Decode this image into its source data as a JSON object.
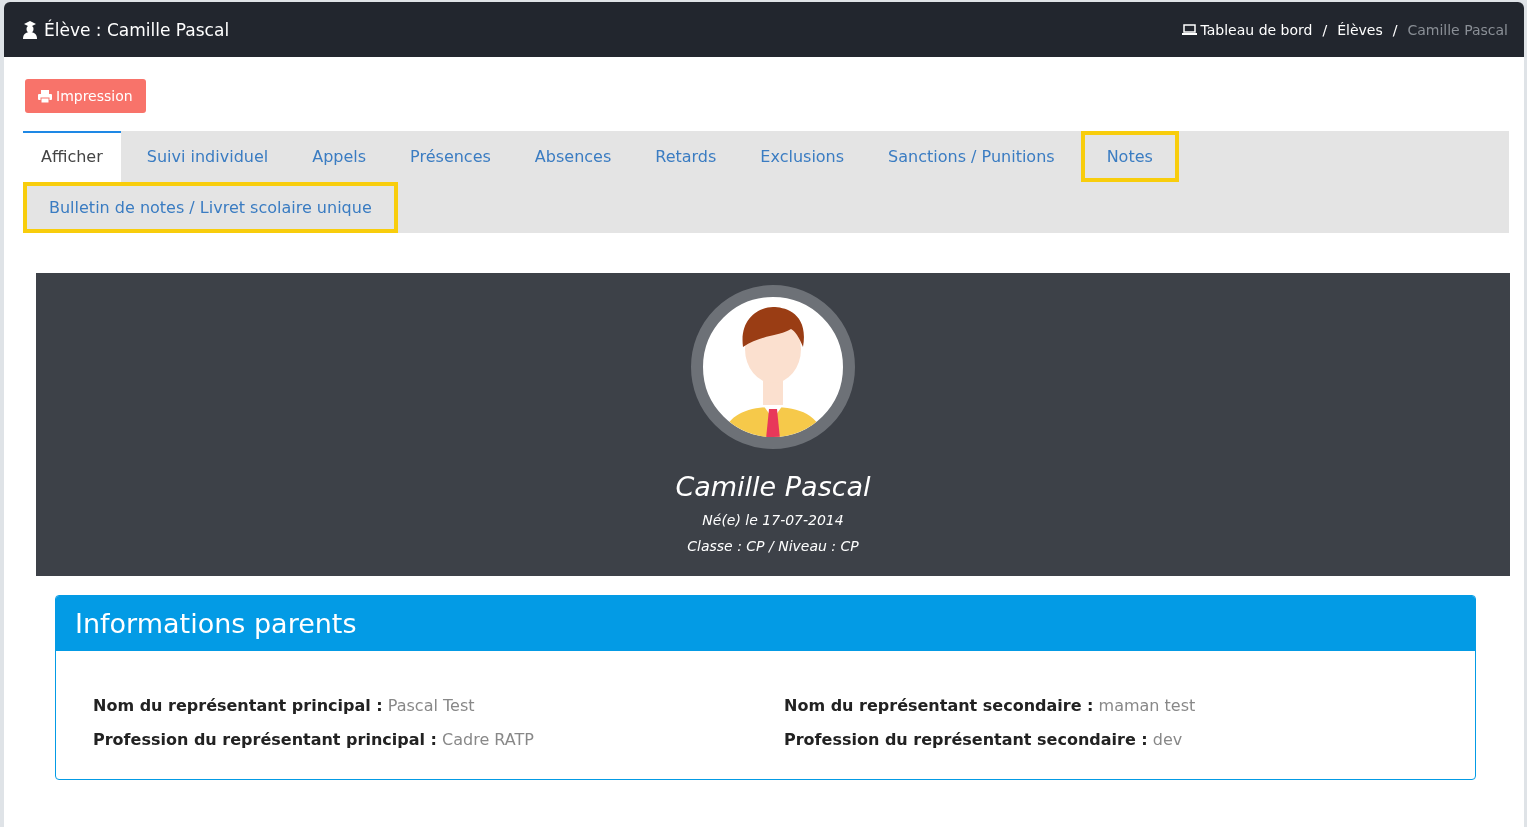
{
  "header": {
    "title": "Élève : Camille Pascal",
    "breadcrumb": [
      {
        "label": "Tableau de bord",
        "current": false
      },
      {
        "label": "Élèves",
        "current": false
      },
      {
        "label": "Camille Pascal",
        "current": true
      }
    ],
    "separator": "/"
  },
  "print_button": "Impression",
  "tabs": [
    {
      "label": "Afficher",
      "selected": true,
      "highlighted": false
    },
    {
      "label": "Suivi individuel",
      "selected": false,
      "highlighted": false
    },
    {
      "label": "Appels",
      "selected": false,
      "highlighted": false
    },
    {
      "label": "Présences",
      "selected": false,
      "highlighted": false
    },
    {
      "label": "Absences",
      "selected": false,
      "highlighted": false
    },
    {
      "label": "Retards",
      "selected": false,
      "highlighted": false
    },
    {
      "label": "Exclusions",
      "selected": false,
      "highlighted": false
    },
    {
      "label": "Sanctions / Punitions",
      "selected": false,
      "highlighted": false
    },
    {
      "label": "Notes",
      "selected": false,
      "highlighted": true
    },
    {
      "label": "Bulletin de notes / Livret scolaire unique",
      "selected": false,
      "highlighted": true
    }
  ],
  "profile": {
    "name": "Camille Pascal",
    "birth": "Né(e) le 17-07-2014",
    "class": "Classe : CP / Niveau : CP"
  },
  "parents": {
    "title": "Informations parents",
    "fields": [
      {
        "label": "Nom du représentant principal :",
        "value": "Pascal Test"
      },
      {
        "label": "Nom du représentant secondaire :",
        "value": "maman test"
      },
      {
        "label": "Profession du représentant principal :",
        "value": "Cadre RATP"
      },
      {
        "label": "Profession du représentant secondaire :",
        "value": "dev"
      }
    ]
  }
}
